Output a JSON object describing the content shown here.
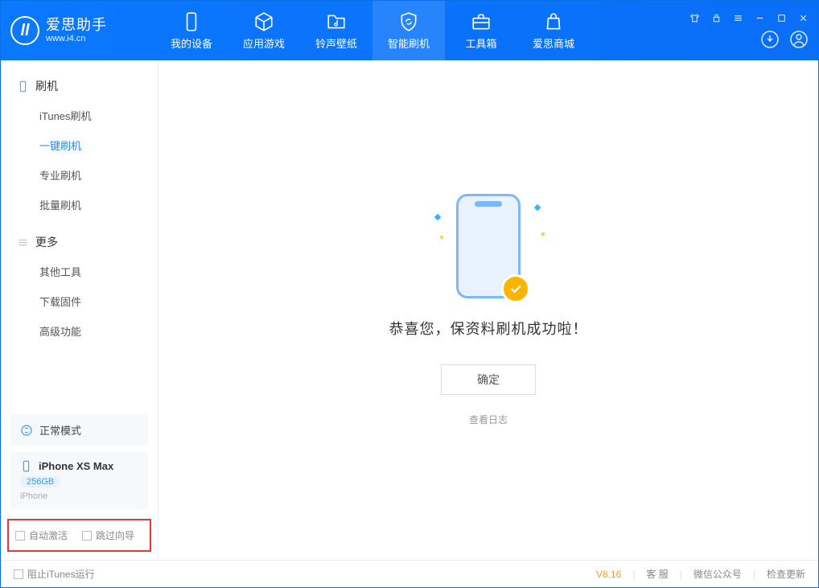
{
  "brand": {
    "name": "爱思助手",
    "url": "www.i4.cn"
  },
  "nav": {
    "device": "我的设备",
    "apps": "应用游戏",
    "ringtone": "铃声壁纸",
    "flash": "智能刷机",
    "toolbox": "工具箱",
    "store": "爱思商城"
  },
  "sidebar": {
    "section_flash": "刷机",
    "items_flash": {
      "itunes": "iTunes刷机",
      "oneclick": "一键刷机",
      "pro": "专业刷机",
      "batch": "批量刷机"
    },
    "section_more": "更多",
    "items_more": {
      "other": "其他工具",
      "firmware": "下载固件",
      "advanced": "高级功能"
    },
    "mode": "正常模式",
    "device": {
      "name": "iPhone XS Max",
      "storage": "256GB",
      "type": "iPhone"
    },
    "checks": {
      "auto_activate": "自动激活",
      "skip_guide": "跳过向导"
    }
  },
  "main": {
    "success": "恭喜您，保资料刷机成功啦！",
    "ok": "确定",
    "log": "查看日志"
  },
  "status": {
    "block_itunes": "阻止iTunes运行",
    "version": "V8.16",
    "support": "客 服",
    "wechat": "微信公众号",
    "update": "检查更新"
  }
}
